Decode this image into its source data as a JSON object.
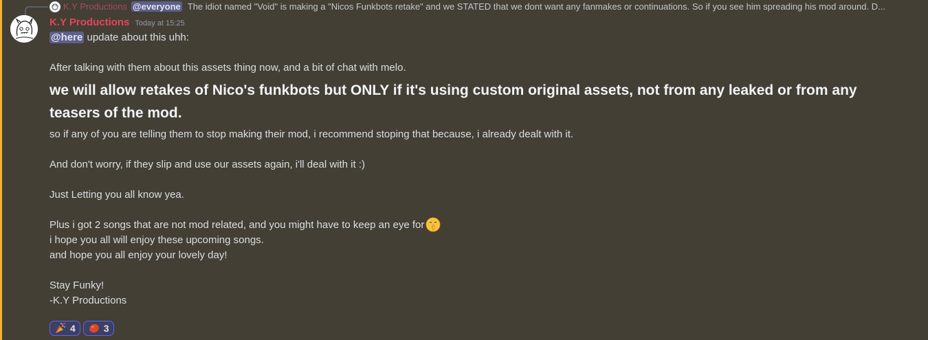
{
  "reply": {
    "author": "K.Y Productions",
    "mention": "@everyone",
    "text": "The idiot named \"Void\" is making a \"Nicos Funkbots retake\" and we STATED that we dont want any fanmakes or continuations.  So if you see him spreading his mod around. D..."
  },
  "message": {
    "author": "K.Y Productions",
    "timestamp": "Today at 15:25",
    "mention": "@here",
    "line1_rest": " update about this uhh:",
    "line2": "After talking with them about this assets thing now, and a bit of chat with melo.",
    "heading": "we will allow retakes of Nico's funkbots but ONLY if it's using custom original assets, not from any leaked or from any teasers of the mod.",
    "line3": "so if any of you are telling them to stop making their mod, i recommend stoping that because, i already dealt with it.",
    "line4": "And don't worry, if they slip and use our assets again, i'll deal with it :)",
    "line5": "Just Letting you all know yea.",
    "line6": "Plus i got 2 songs that are not mod related, and you might have to keep an eye for",
    "line6_emoji": "shushing-face-icon",
    "line7": "i hope you all will enjoy these upcoming songs.",
    "line8": "and hope you all enjoy your lovely day!",
    "line9": "Stay Funky!",
    "line10": "-K.Y Productions"
  },
  "reactions": [
    {
      "emoji": "party-popper-icon",
      "count": "4"
    },
    {
      "emoji": "red-blob-icon",
      "count": "3"
    }
  ],
  "colors": {
    "background": "#433f35",
    "mention_bar": "#f0b232",
    "author": "#e8435e",
    "mention_bg": "#5d5f8a",
    "reaction_border": "#5865f2"
  }
}
